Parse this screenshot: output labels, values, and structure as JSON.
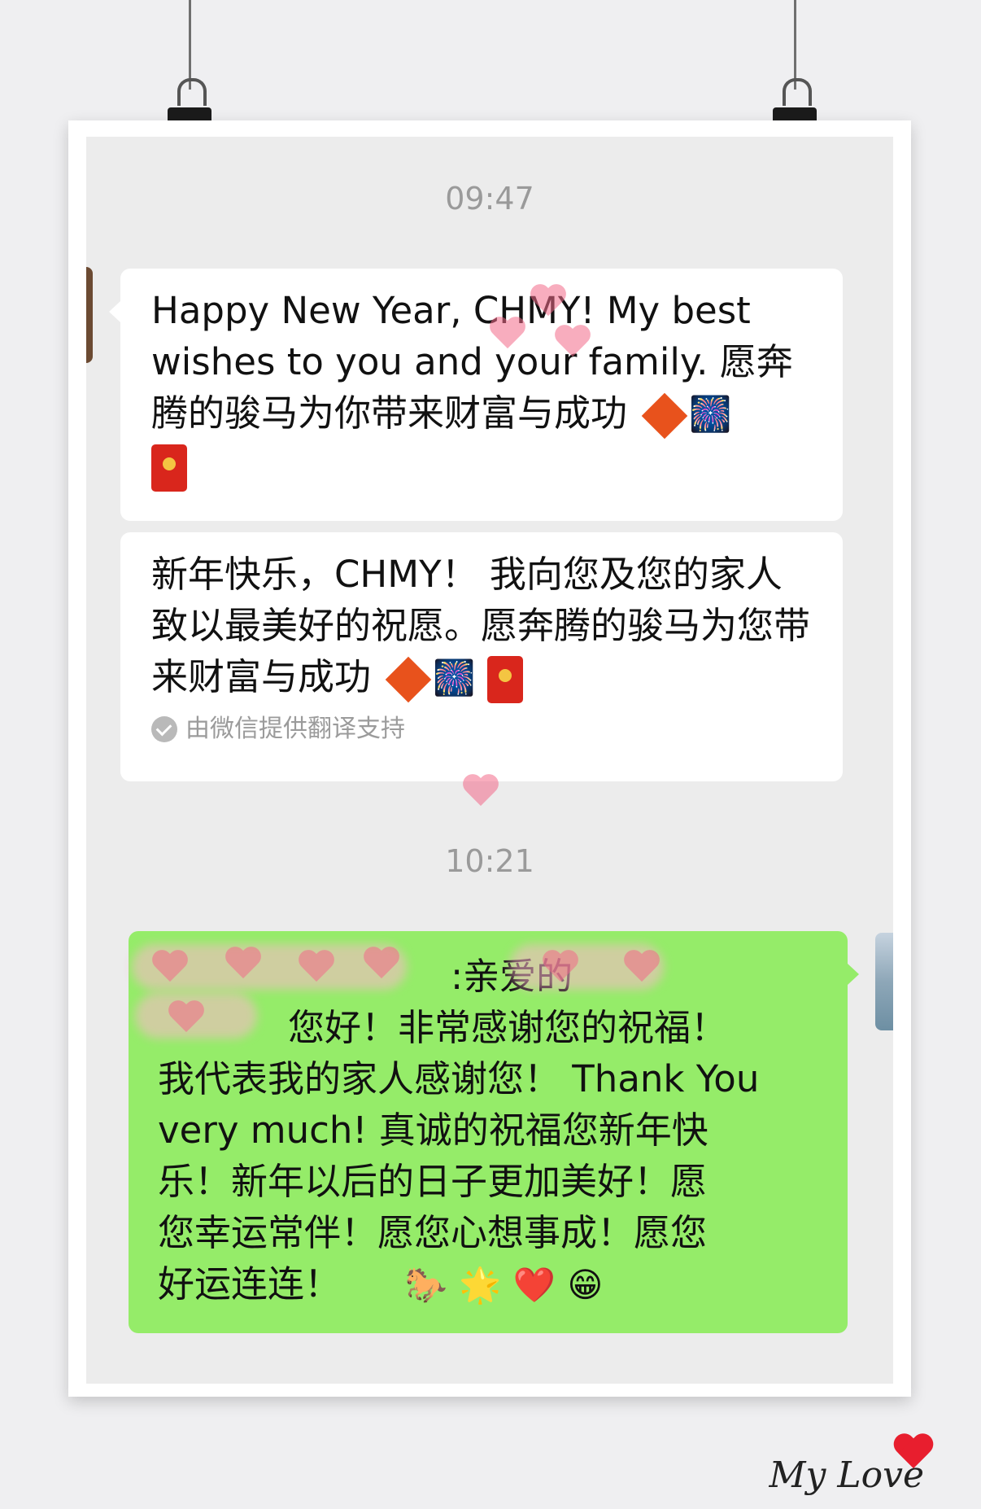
{
  "conversation": {
    "timestamps": [
      "09:47",
      "10:21"
    ],
    "messages": [
      {
        "side": "received",
        "text": "Happy New Year, CHMY! My best wishes to you and your family. 愿奔腾的骏马为你带来财富与成功",
        "emoji": [
          "fu-diamond-icon",
          "fireworks-icon",
          "red-packet-icon"
        ]
      },
      {
        "side": "received",
        "text": "新年快乐，CHMY！ 我向您及您的家人致以最美好的祝愿。愿奔腾的骏马为您带来财富与成功",
        "emoji": [
          "fu-diamond-icon",
          "fireworks-icon",
          "red-packet-icon"
        ],
        "translation_note": "由微信提供翻译支持"
      },
      {
        "side": "sent",
        "text_lines": [
          ":亲爱的",
          "您好！非常感谢您的祝福！",
          "我代表我的家人感谢您！ Thank You",
          "very much! 真诚的祝福您新年快",
          "乐！新年以后的日子更加美好！愿",
          "您幸运常伴！愿您心想事成！愿您",
          "好运连连！"
        ],
        "emoji_tail": [
          "horse-icon",
          "star-icon",
          "heart-icon",
          "grin-icon"
        ]
      }
    ]
  },
  "signature": "My Love",
  "colors": {
    "received_bubble": "#ffffff",
    "sent_bubble": "#95ec69",
    "chat_bg": "#ececec",
    "timestamp": "#9a9a9a"
  }
}
